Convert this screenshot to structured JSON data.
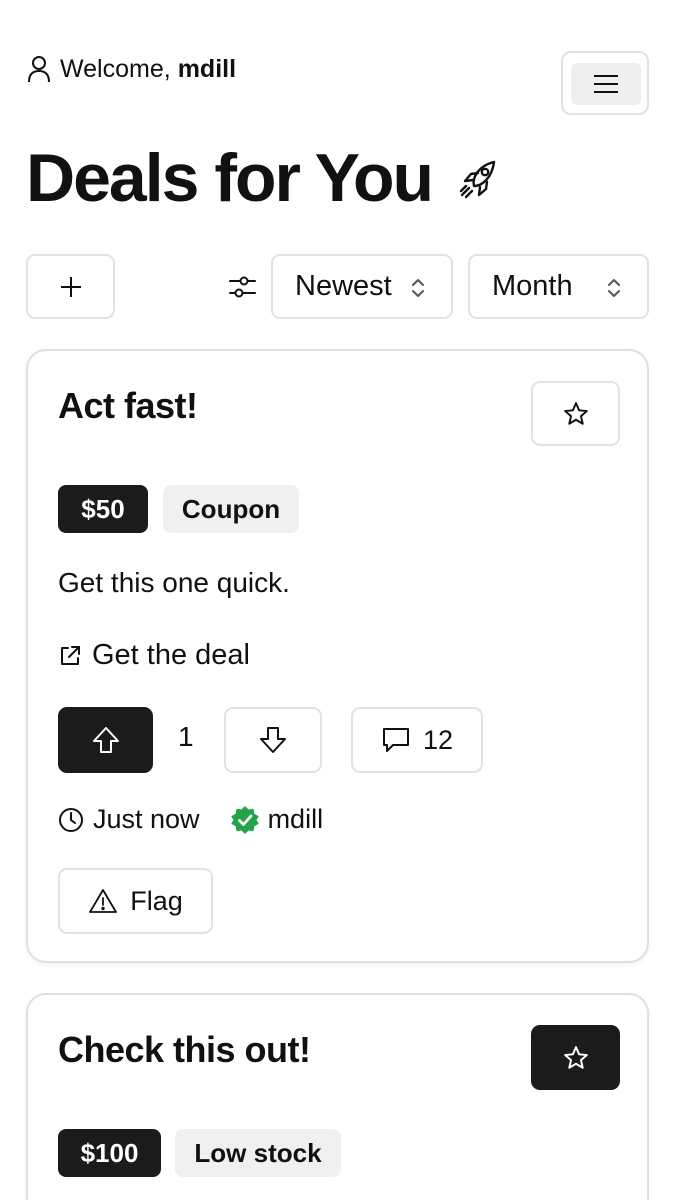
{
  "header": {
    "welcome_text": "Welcome,",
    "username": "mdill",
    "title": "Deals for You"
  },
  "toolbar": {
    "sort_value": "Newest",
    "period_value": "Month"
  },
  "icons": {
    "user": "user-icon",
    "menu": "hamburger-menu-icon",
    "title_decoration": "rocket-icon",
    "add": "plus-icon",
    "filters": "sliders-icon",
    "sort_chevron": "chevron-up-down-icon",
    "favorite": "star-icon",
    "external": "external-link-icon",
    "upvote": "arrow-up-icon",
    "downvote": "arrow-down-icon",
    "comments": "message-icon",
    "time": "clock-icon",
    "verified": "verified-badge-icon",
    "flag": "warning-triangle-icon"
  },
  "colors": {
    "primary_dark": "#1b1b1b",
    "border": "#e2e2e2",
    "tag_light": "#f0f0f0",
    "verified_green": "#22a447"
  },
  "deals": [
    {
      "title": "Act fast!",
      "favorited": false,
      "price": "$50",
      "tag": "Coupon",
      "description": "Get this one quick.",
      "link_text": "Get the deal",
      "votes": "1",
      "comments": "12",
      "time": "Just now",
      "author": "mdill",
      "flag_label": "Flag"
    },
    {
      "title": "Check this out!",
      "favorited": true,
      "price": "$100",
      "tag": "Low stock"
    }
  ]
}
